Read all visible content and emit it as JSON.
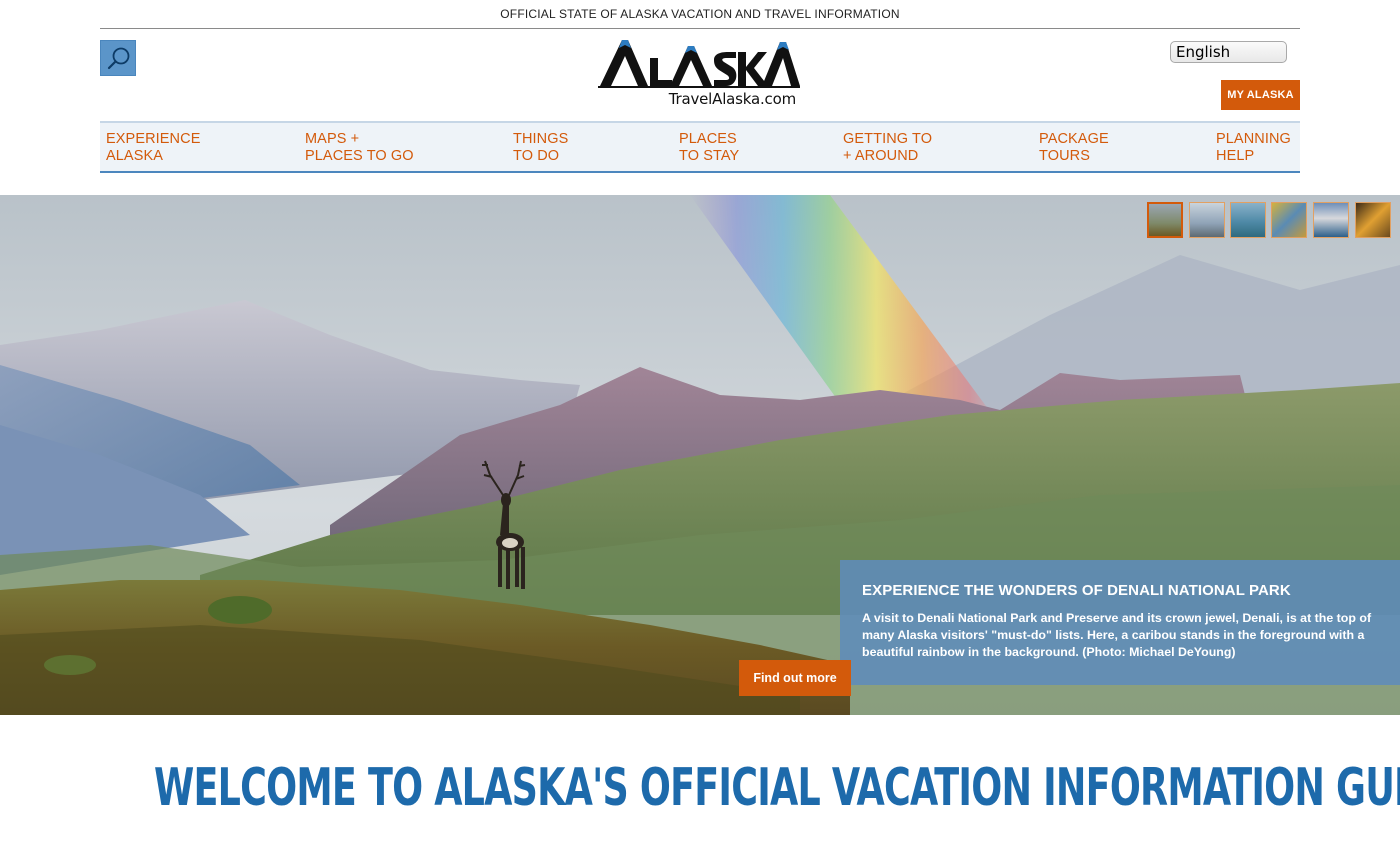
{
  "topbar": {
    "text": "OFFICIAL STATE OF ALASKA VACATION AND TRAVEL INFORMATION"
  },
  "header": {
    "search_icon": "search-icon",
    "logo_text": "ALASKA",
    "logo_tagline": "TravelAlaska.com",
    "language": "English",
    "my_alaska": "MY ALASKA"
  },
  "nav": {
    "items": [
      {
        "line1": "EXPERIENCE",
        "line2": "ALASKA"
      },
      {
        "line1": "MAPS +",
        "line2": "PLACES TO GO"
      },
      {
        "line1": "THINGS",
        "line2": "TO DO"
      },
      {
        "line1": "PLACES",
        "line2": "TO STAY"
      },
      {
        "line1": "GETTING TO",
        "line2": "+ AROUND"
      },
      {
        "line1": "PACKAGE",
        "line2": "TOURS"
      },
      {
        "line1": "PLANNING",
        "line2": "HELP"
      }
    ]
  },
  "hero": {
    "slides_count": 6,
    "active_slide": 1,
    "caption_title": "EXPERIENCE THE WONDERS OF DENALI NATIONAL PARK",
    "caption_body": "A visit to Denali National Park and Preserve and its crown jewel, Denali, is at the top of many Alaska visitors' \"must-do\" lists. Here, a caribou stands in the foreground with a beautiful rainbow in the background. (Photo: Michael DeYoung)",
    "cta": "Find out more"
  },
  "welcome": {
    "heading": "WELCOME TO ALASKA'S OFFICIAL VACATION INFORMATION GUIDE"
  },
  "colors": {
    "accent_orange": "#d35a0b",
    "brand_blue": "#1d6aab",
    "caption_blue": "#5e8cbb",
    "nav_bg": "#eef3f8"
  }
}
